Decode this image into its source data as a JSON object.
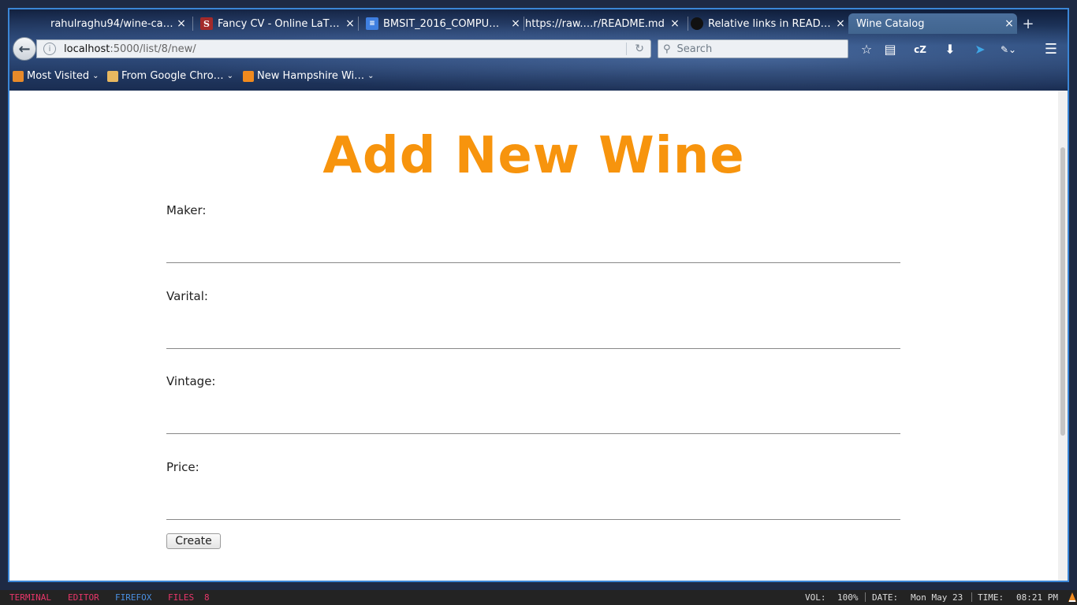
{
  "browser": {
    "tabs": [
      {
        "title": "rahulraghu94/wine-ca…",
        "icon": "github-icon",
        "active": false
      },
      {
        "title": "Fancy CV - Online LaT…",
        "icon": "sharelatex-icon",
        "active": false
      },
      {
        "title": "BMSIT_2016_COMPU…",
        "icon": "docs-icon",
        "active": false
      },
      {
        "title": "https://raw.…r/README.md",
        "icon": "",
        "active": false
      },
      {
        "title": "Relative links in READ…",
        "icon": "github-icon",
        "active": false
      },
      {
        "title": "Wine Catalog",
        "icon": "",
        "active": true
      }
    ],
    "url": {
      "host": "localhost",
      "path": ":5000/list/8/new/"
    },
    "search_placeholder": "Search",
    "bookmarks": [
      {
        "label": "Most Visited",
        "icon": "most-visited-icon"
      },
      {
        "label": "From Google Chro…",
        "icon": "folder-icon"
      },
      {
        "label": "New Hampshire Wi…",
        "icon": "rss-icon"
      }
    ],
    "toolbar_cz": "cZ"
  },
  "page": {
    "title": "Add New Wine",
    "fields": [
      {
        "label": "Maker:",
        "value": ""
      },
      {
        "label": "Varital:",
        "value": ""
      },
      {
        "label": "Vintage:",
        "value": ""
      },
      {
        "label": "Price:",
        "value": ""
      }
    ],
    "submit_label": "Create"
  },
  "statusbar": {
    "workspaces": [
      {
        "label": "TERMINAL",
        "color": "#e8366a"
      },
      {
        "label": "EDITOR",
        "color": "#e8366a"
      },
      {
        "label": "FIREFOX",
        "color": "#4a8fe0"
      },
      {
        "label": "FILES",
        "color": "#e8366a"
      },
      {
        "label": "8",
        "color": "#e8366a"
      }
    ],
    "vol_label": "VOL:",
    "vol_value": "100%",
    "date_label": "DATE:",
    "date_value": "Mon May 23",
    "time_label": "TIME:",
    "time_value": "08:21 PM"
  },
  "colors": {
    "accent_title": "#f7940d",
    "window_border": "#3b86d6"
  }
}
